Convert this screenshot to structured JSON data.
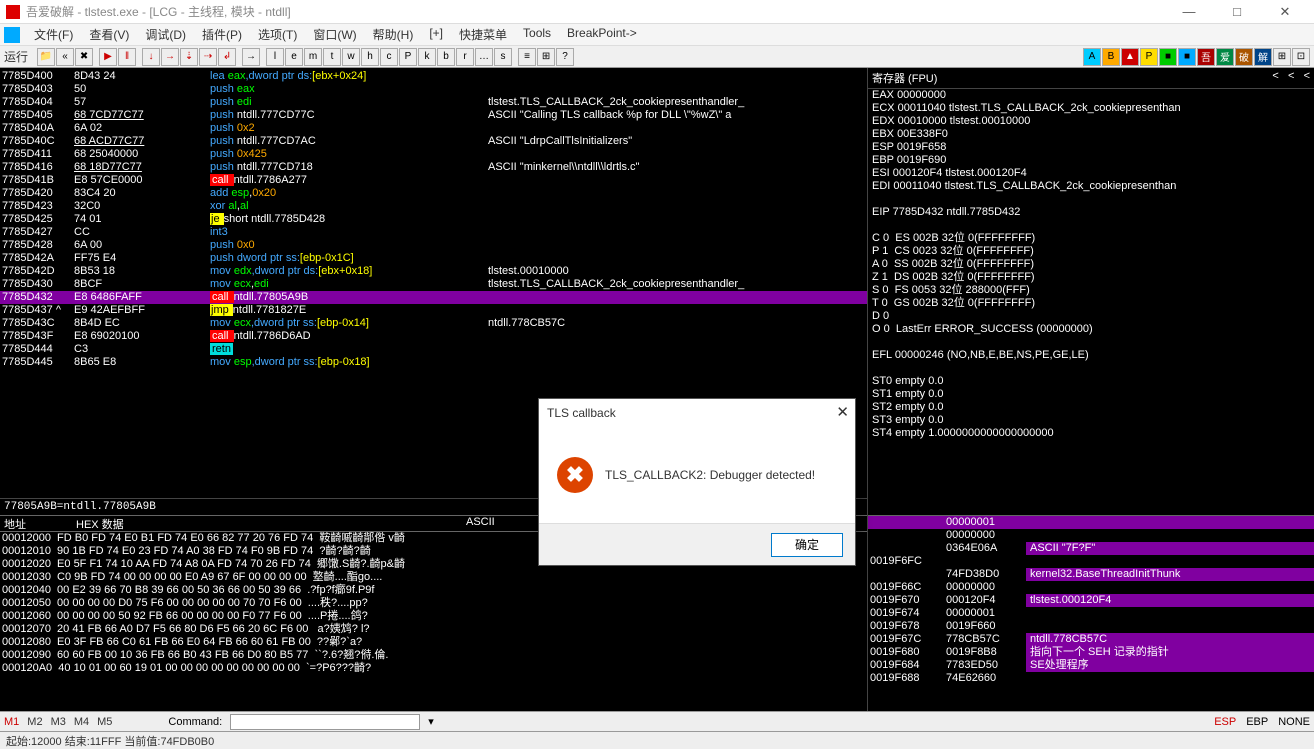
{
  "title": "吾爱破解 - tlstest.exe - [LCG - 主线程, 模块 - ntdll]",
  "menus": [
    "文件(F)",
    "查看(V)",
    "调试(D)",
    "插件(P)",
    "选项(T)",
    "窗口(W)",
    "帮助(H)",
    "[+]",
    "快捷菜单",
    "Tools",
    "BreakPoint->"
  ],
  "toolbar_run": "运行",
  "disasm": [
    {
      "addr": "7785D400",
      "bytes": "8D43 24",
      "instr": [
        {
          "t": "lea ",
          "c": "blue"
        },
        {
          "t": "eax",
          "c": "green"
        },
        {
          "t": ",dword ptr ds:",
          "c": "blue"
        },
        {
          "t": "[ebx+0x24]",
          "c": "yellow"
        }
      ],
      "cmt": ""
    },
    {
      "addr": "7785D403",
      "bytes": "50",
      "instr": [
        {
          "t": "push ",
          "c": "blue"
        },
        {
          "t": "eax",
          "c": "green"
        }
      ],
      "cmt": ""
    },
    {
      "addr": "7785D404",
      "bytes": "57",
      "instr": [
        {
          "t": "push ",
          "c": "blue"
        },
        {
          "t": "edi",
          "c": "green"
        }
      ],
      "cmt": "tlstest.TLS_CALLBACK_2ck_cookiepresenthandler_"
    },
    {
      "addr": "7785D405",
      "bytes": "68 7CD77C77",
      "instr": [
        {
          "t": "push ",
          "c": "blue"
        },
        {
          "t": "ntdll.777CD77C",
          "c": ""
        }
      ],
      "cmt": "ASCII \"Calling TLS callback %p for DLL \\\"%wZ\\\" a",
      "ul": true
    },
    {
      "addr": "7785D40A",
      "bytes": "6A 02",
      "instr": [
        {
          "t": "push ",
          "c": "blue"
        },
        {
          "t": "0x2",
          "c": "orange"
        }
      ],
      "cmt": ""
    },
    {
      "addr": "7785D40C",
      "bytes": "68 ACD77C77",
      "instr": [
        {
          "t": "push ",
          "c": "blue"
        },
        {
          "t": "ntdll.777CD7AC",
          "c": ""
        }
      ],
      "cmt": "ASCII \"LdrpCallTlsInitializers\"",
      "ul": true
    },
    {
      "addr": "7785D411",
      "bytes": "68 25040000",
      "instr": [
        {
          "t": "push ",
          "c": "blue"
        },
        {
          "t": "0x425",
          "c": "orange"
        }
      ],
      "cmt": ""
    },
    {
      "addr": "7785D416",
      "bytes": "68 18D77C77",
      "instr": [
        {
          "t": "push ",
          "c": "blue"
        },
        {
          "t": "ntdll.777CD718",
          "c": ""
        }
      ],
      "cmt": "ASCII \"minkernel\\\\ntdll\\\\ldrtls.c\"",
      "ul": true
    },
    {
      "addr": "7785D41B",
      "bytes": "E8 57CE0000",
      "instr": [
        {
          "t": "call ",
          "c": "red2"
        },
        {
          "t": "ntdll.7786A277",
          "c": ""
        }
      ],
      "cmt": ""
    },
    {
      "addr": "7785D420",
      "bytes": "83C4 20",
      "instr": [
        {
          "t": "add ",
          "c": "blue"
        },
        {
          "t": "esp",
          "c": "green"
        },
        {
          "t": ",",
          "c": ""
        },
        {
          "t": "0x20",
          "c": "orange"
        }
      ],
      "cmt": ""
    },
    {
      "addr": "7785D423",
      "bytes": "32C0",
      "instr": [
        {
          "t": "xor ",
          "c": "blue"
        },
        {
          "t": "al",
          "c": "green"
        },
        {
          "t": ",",
          "c": ""
        },
        {
          "t": "al",
          "c": "green"
        }
      ],
      "cmt": ""
    },
    {
      "addr": "7785D425",
      "bytes": "74 01",
      "instr": [
        {
          "t": "je ",
          "c": "ylw-hl"
        },
        {
          "t": "short ntdll.7785D428",
          "c": ""
        }
      ],
      "cmt": ""
    },
    {
      "addr": "7785D427",
      "bytes": "CC",
      "instr": [
        {
          "t": "int3",
          "c": "blue"
        }
      ],
      "cmt": ""
    },
    {
      "addr": "7785D428",
      "bytes": "6A 00",
      "instr": [
        {
          "t": "push ",
          "c": "blue"
        },
        {
          "t": "0x0",
          "c": "orange"
        }
      ],
      "cmt": ""
    },
    {
      "addr": "7785D42A",
      "bytes": "FF75 E4",
      "instr": [
        {
          "t": "push ",
          "c": "blue"
        },
        {
          "t": "dword ptr ss:",
          "c": "blue"
        },
        {
          "t": "[ebp-0x1C]",
          "c": "yellow"
        }
      ],
      "cmt": ""
    },
    {
      "addr": "7785D42D",
      "bytes": "8B53 18",
      "instr": [
        {
          "t": "mov ",
          "c": "blue"
        },
        {
          "t": "edx",
          "c": "green"
        },
        {
          "t": ",dword ptr ds:",
          "c": "blue"
        },
        {
          "t": "[ebx+0x18]",
          "c": "yellow"
        }
      ],
      "cmt": "tlstest.00010000"
    },
    {
      "addr": "7785D430",
      "bytes": "8BCF",
      "instr": [
        {
          "t": "mov ",
          "c": "blue"
        },
        {
          "t": "ecx",
          "c": "green"
        },
        {
          "t": ",",
          "c": ""
        },
        {
          "t": "edi",
          "c": "green"
        }
      ],
      "cmt": "tlstest.TLS_CALLBACK_2ck_cookiepresenthandler_"
    },
    {
      "addr": "7785D432",
      "bytes": "E8 6486FAFF",
      "instr": [
        {
          "t": "call ",
          "c": "red2"
        },
        {
          "t": "ntdll.77805A9B",
          "c": ""
        }
      ],
      "cmt": "",
      "hl": true
    },
    {
      "addr": "7785D437",
      "bytes": "E9 42AEFBFF",
      "instr": [
        {
          "t": "jmp ",
          "c": "ylw-hl"
        },
        {
          "t": "ntdll.7781827E",
          "c": ""
        }
      ],
      "cmt": "",
      "jmp": true
    },
    {
      "addr": "7785D43C",
      "bytes": "8B4D EC",
      "instr": [
        {
          "t": "mov ",
          "c": "blue"
        },
        {
          "t": "ecx",
          "c": "green"
        },
        {
          "t": ",dword ptr ss:",
          "c": "blue"
        },
        {
          "t": "[ebp-0x14]",
          "c": "yellow"
        }
      ],
      "cmt": "ntdll.778CB57C"
    },
    {
      "addr": "7785D43F",
      "bytes": "E8 69020100",
      "instr": [
        {
          "t": "call ",
          "c": "red2"
        },
        {
          "t": "ntdll.7786D6AD",
          "c": ""
        }
      ],
      "cmt": ""
    },
    {
      "addr": "7785D444",
      "bytes": "C3",
      "instr": [
        {
          "t": "retn",
          "c": "teal"
        }
      ],
      "cmt": ""
    },
    {
      "addr": "7785D445",
      "bytes": "8B65 E8",
      "instr": [
        {
          "t": "mov ",
          "c": "blue"
        },
        {
          "t": "esp",
          "c": "green"
        },
        {
          "t": ",dword ptr ss:",
          "c": "blue"
        },
        {
          "t": "[ebp-0x18]",
          "c": "yellow"
        }
      ],
      "cmt": ""
    }
  ],
  "info_line": "77805A9B=ntdll.77805A9B",
  "dump_head": {
    "addr": "地址",
    "hex": "HEX 数据",
    "ascii": "ASCII"
  },
  "dump": [
    {
      "a": "00012000",
      "h": "FD B0 FD 74 E0 B1 FD 74 E0 66 82 77 20 76 FD 74",
      "s": "鞍齮嘁齮鄁倃 v齮"
    },
    {
      "a": "00012010",
      "h": "90 1B FD 74 E0 23 FD 74 A0 38 FD 74 F0 9B FD 74",
      "s": "?齮?齮?齮"
    },
    {
      "a": "00012020",
      "h": "E0 5F F1 74 10 AA FD 74 A8 0A FD 74 70 26 FD 74",
      "s": "郷馓.S齮?.齮p&齮"
    },
    {
      "a": "00012030",
      "h": "C0 9B FD 74 00 00 00 00 E0 A9 67 6F 00 00 00 00",
      "s": "墪齮....酯go...."
    },
    {
      "a": "00012040",
      "h": "00 E2 39 66 70 B8 39 66 00 50 36 66 00 50 39 66",
      "s": ".?fp?f癤9f.P9f"
    },
    {
      "a": "00012050",
      "h": "00 00 00 00 D0 75 F6 00 00 00 00 00 70 70 F6 00",
      "s": "....秩?....pp?"
    },
    {
      "a": "00012060",
      "h": "00 00 00 00 50 92 FB 66 00 00 00 00 F0 77 F6 00",
      "s": "....P捲....鸽?"
    },
    {
      "a": "00012070",
      "h": "20 41 FB 66 A0 D7 F5 66 80 D6 F5 66 20 6C F6 00",
      "s": " a?姨鸩? l?"
    },
    {
      "a": "00012080",
      "h": "E0 3F FB 66 C0 61 FB 66 E0 64 FB 66 60 61 FB 00",
      "s": "??鄵?`a?"
    },
    {
      "a": "00012090",
      "h": "60 60 FB 00 10 36 FB 66 B0 43 FB 66 D0 80 B5 77",
      "s": "``?.6?翘?偫.倫."
    },
    {
      "a": "000120A0",
      "h": "40 10 01 00 60 19 01 00 00 00 00 00 00 00 00 00",
      "s": "`=?P6???齮?"
    }
  ],
  "regs_title": "寄存器 (FPU)",
  "regs": [
    "EAX 00000000",
    "ECX 00011040 tlstest.TLS_CALLBACK_2ck_cookiepresenthan",
    "EDX 00010000 tlstest.00010000",
    "EBX 00E338F0",
    "ESP 0019F658",
    "EBP 0019F690",
    "ESI 000120F4 tlstest.000120F4",
    "EDI 00011040 tlstest.TLS_CALLBACK_2ck_cookiepresenthan",
    "",
    "EIP 7785D432 ntdll.7785D432",
    "",
    "C 0  ES 002B 32位 0(FFFFFFFF)",
    "P 1  CS 0023 32位 0(FFFFFFFF)",
    "A 0  SS 002B 32位 0(FFFFFFFF)",
    "Z 1  DS 002B 32位 0(FFFFFFFF)",
    "S 0  FS 0053 32位 288000(FFF)",
    "T 0  GS 002B 32位 0(FFFFFFFF)",
    "D 0",
    "O 0  LastErr ERROR_SUCCESS (00000000)",
    "",
    "EFL 00000246 (NO,NB,E,BE,NS,PE,GE,LE)",
    "",
    "ST0 empty 0.0",
    "ST1 empty 0.0",
    "ST2 empty 0.0",
    "ST3 empty 0.0",
    "ST4 empty 1.0000000000000000000"
  ],
  "stack": [
    {
      "a": "",
      "v": "00000001",
      "c": "",
      "hl": true
    },
    {
      "a": "",
      "v": "00000000",
      "c": ""
    },
    {
      "a": "",
      "v": "0364E06A",
      "c": "ASCII \"7F?F\"",
      "hc": true
    },
    {
      "a": "0019F6FC",
      "v": "",
      "c": ""
    },
    {
      "a": "",
      "v": "74FD38D0",
      "c": "kernel32.BaseThreadInitThunk",
      "hc": true
    },
    {
      "a": "0019F66C",
      "v": "00000000",
      "c": ""
    },
    {
      "a": "0019F670",
      "v": "000120F4",
      "c": "tlstest.000120F4",
      "hc": true
    },
    {
      "a": "0019F674",
      "v": "00000001",
      "c": ""
    },
    {
      "a": "0019F678",
      "v": "0019F660",
      "c": ""
    },
    {
      "a": "0019F67C",
      "v": "778CB57C",
      "c": "ntdll.778CB57C",
      "hc": true
    },
    {
      "a": "0019F680",
      "v": "0019F8B8",
      "c": "指向下一个 SEH 记录的指针",
      "hc": true
    },
    {
      "a": "0019F684",
      "v": "7783ED50",
      "c": "SE处理程序",
      "hc": true
    },
    {
      "a": "0019F688",
      "v": "74E62660",
      "c": ""
    }
  ],
  "cmdbar": {
    "m1": "M1",
    "m2": "M2",
    "m3": "M3",
    "m4": "M4",
    "m5": "M5",
    "cmd_label": "Command:",
    "esp": "ESP",
    "ebp": "EBP",
    "none": "NONE"
  },
  "status": "起始:12000 结束:11FFF 当前值:74FDB0B0",
  "dialog": {
    "title": "TLS callback",
    "msg": "TLS_CALLBACK2: Debugger detected!",
    "ok": "确定"
  }
}
